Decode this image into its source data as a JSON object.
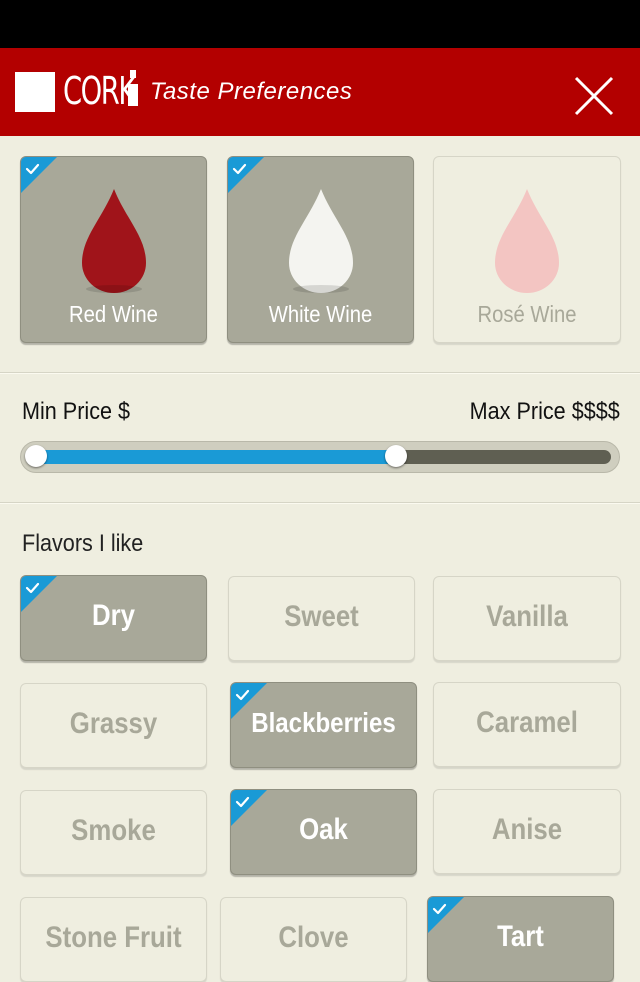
{
  "header": {
    "logo_text": "CORK",
    "title": "Taste Preferences",
    "brand_color": "#b30000"
  },
  "wines": [
    {
      "label": "Red Wine",
      "selected": true,
      "drop_color": "#a0141a"
    },
    {
      "label": "White Wine",
      "selected": true,
      "drop_color": "#f4f4f0"
    },
    {
      "label": "Rosé Wine",
      "selected": false,
      "drop_color": "#f3c5c2"
    }
  ],
  "price": {
    "min_label": "Min Price $",
    "max_label": "Max Price $$$$",
    "range_fraction": [
      0.0,
      0.63
    ],
    "accent_color": "#1a9ad6"
  },
  "flavors": {
    "title": "Flavors I like",
    "items": [
      {
        "label": "Dry",
        "selected": true
      },
      {
        "label": "Sweet",
        "selected": false
      },
      {
        "label": "Vanilla",
        "selected": false
      },
      {
        "label": "Grassy",
        "selected": false
      },
      {
        "label": "Blackberries",
        "selected": true
      },
      {
        "label": "Caramel",
        "selected": false
      },
      {
        "label": "Smoke",
        "selected": false
      },
      {
        "label": "Oak",
        "selected": true
      },
      {
        "label": "Anise",
        "selected": false
      },
      {
        "label": "Stone Fruit",
        "selected": false
      },
      {
        "label": "Clove",
        "selected": false
      },
      {
        "label": "Tart",
        "selected": true
      }
    ]
  },
  "icons": {
    "close": "close-x-icon",
    "check": "checkmark-corner-icon",
    "drop": "wine-drop-icon"
  }
}
